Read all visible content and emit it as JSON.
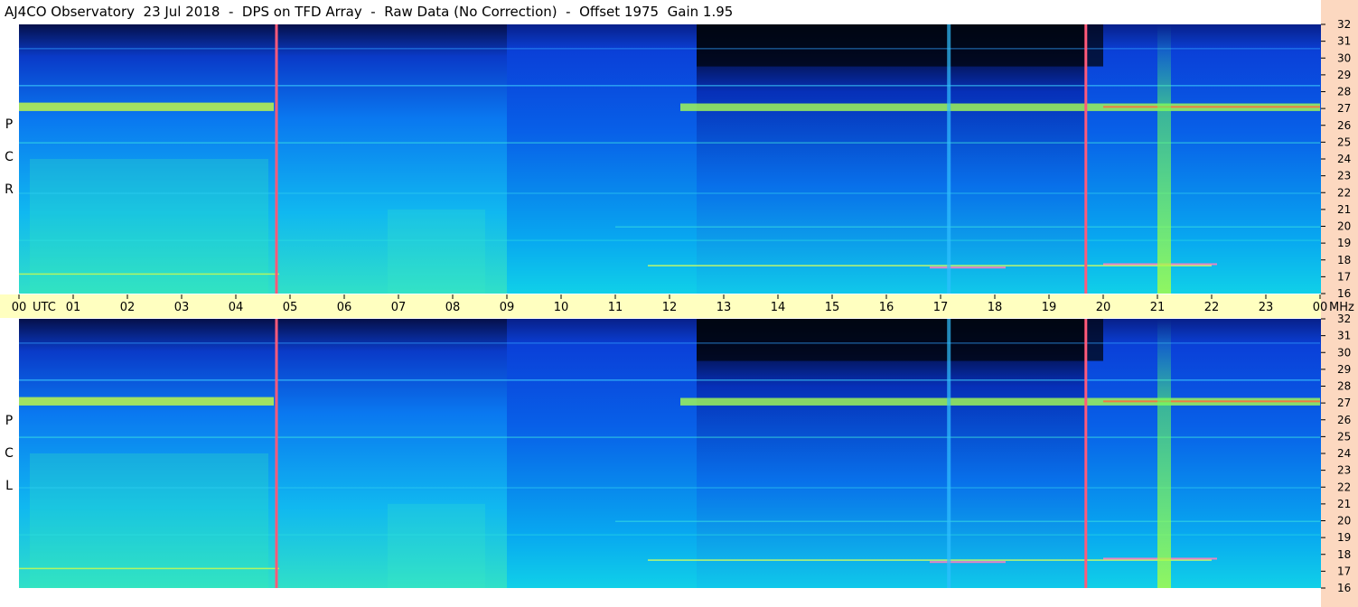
{
  "title": "AJ4CO Observatory  23 Jul 2018  -  DPS on TFD Array  -  Raw Data (No Correction)  -  Offset 1975  Gain 1.95",
  "colors": {
    "time_axis_bg": "#ffffc0",
    "freq_axis_bg": "#fcd8c0",
    "marker_line": "#ff5a7a"
  },
  "chart_data": [
    {
      "type": "heatmap",
      "polarization": "RCP",
      "label_letters": [
        "P",
        "C",
        "R"
      ],
      "x_unit": "UTC",
      "y_unit": "MHz",
      "xlim": [
        0,
        24
      ],
      "ylim": [
        16,
        32
      ],
      "freq_ticks": [
        32,
        31,
        30,
        29,
        28,
        27,
        26,
        25,
        24,
        23,
        22,
        21,
        20,
        19,
        18,
        17,
        16
      ],
      "vertical_markers_utc": [
        4.75,
        19.68
      ]
    },
    {
      "type": "heatmap",
      "polarization": "LCP",
      "label_letters": [
        "P",
        "C",
        "L"
      ],
      "x_unit": "UTC",
      "y_unit": "MHz",
      "xlim": [
        0,
        24
      ],
      "ylim": [
        16,
        32
      ],
      "freq_ticks": [
        32,
        31,
        30,
        29,
        28,
        27,
        26,
        25,
        24,
        23,
        22,
        21,
        20,
        19,
        18,
        17,
        16
      ],
      "vertical_markers_utc": [
        4.75,
        19.68
      ]
    }
  ],
  "time_axis": {
    "labels": [
      "00",
      "UTC",
      "01",
      "02",
      "03",
      "04",
      "05",
      "06",
      "07",
      "08",
      "09",
      "10",
      "11",
      "12",
      "13",
      "14",
      "15",
      "16",
      "17",
      "18",
      "19",
      "20",
      "21",
      "22",
      "23",
      "00",
      "MHz"
    ]
  }
}
